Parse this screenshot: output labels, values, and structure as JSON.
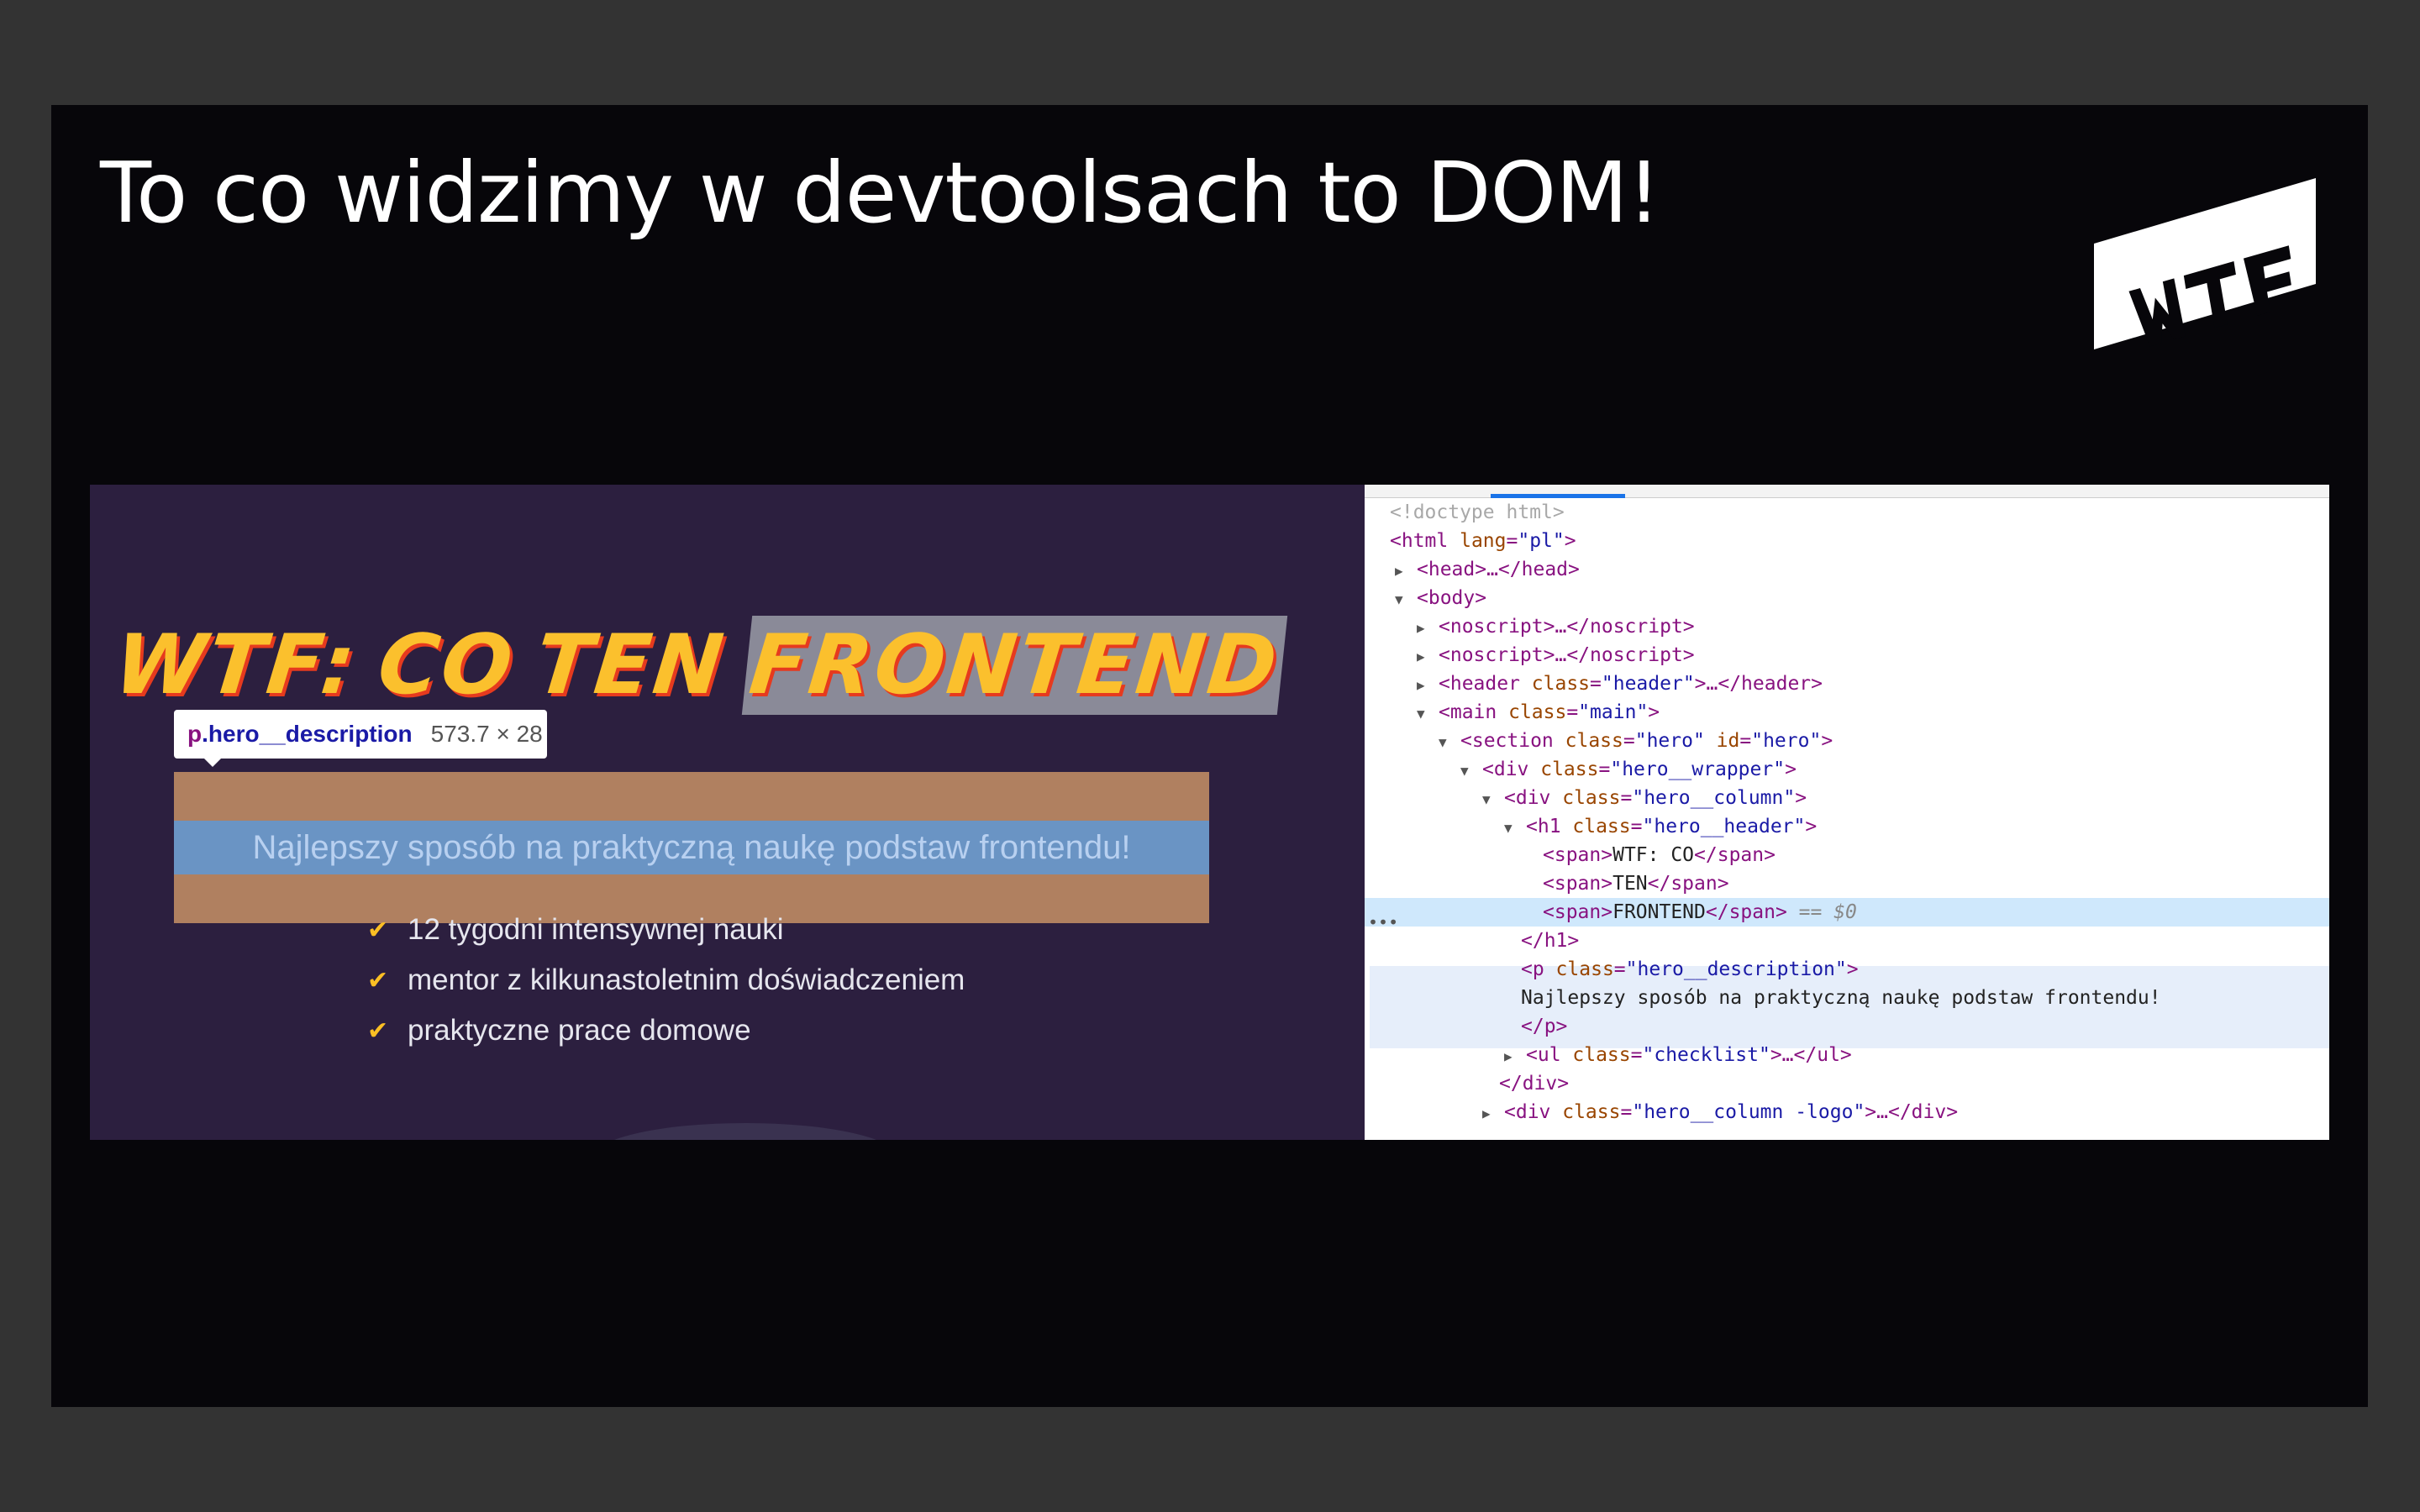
{
  "slide": {
    "title": "To co widzimy w devtoolsach to DOM!",
    "logo_text": "WTF"
  },
  "preview": {
    "heading_words": [
      "WTF:",
      "CO",
      "TEN",
      "FRONTEND"
    ],
    "tooltip": {
      "tag": "p",
      "class": ".hero__description",
      "size": "573.7 × 28"
    },
    "description": "Najlepszy sposób na praktyczną naukę podstaw frontendu!",
    "checklist": [
      "12 tygodni intensywnej nauki",
      "mentor z kilkunastoletnim doświadczeniem",
      "praktyczne prace domowe"
    ],
    "check_icon": "✔"
  },
  "devtools": {
    "selected_suffix": "== $0",
    "dots": "•••",
    "lines": {
      "l1": "<!doctype html>",
      "l2_tag": "<html",
      "l2_attr": " lang",
      "l2_val": "\"pl\"",
      "l2_end": ">",
      "l3": "<head>…</head>",
      "l4": "<body>",
      "l5": "<noscript>…</noscript>",
      "l6": "<noscript>…</noscript>",
      "l7_tag": "<header",
      "l7_attr": " class",
      "l7_val": "\"header\"",
      "l7_end": ">…</header>",
      "l8_tag": "<main",
      "l8_attr": " class",
      "l8_val": "\"main\"",
      "l8_end": ">",
      "l9_tag": "<section",
      "l9_attr": " class",
      "l9_val": "\"hero\"",
      "l9_attr2": " id",
      "l9_val2": "\"hero\"",
      "l9_end": ">",
      "l10_tag": "<div",
      "l10_attr": " class",
      "l10_val": "\"hero__wrapper\"",
      "l10_end": ">",
      "l11_tag": "<div",
      "l11_attr": " class",
      "l11_val": "\"hero__column\"",
      "l11_end": ">",
      "l12_tag": "<h1",
      "l12_attr": " class",
      "l12_val": "\"hero__header\"",
      "l12_end": ">",
      "l13_open": "<span>",
      "l13_text": "WTF: CO",
      "l13_close": "</span>",
      "l14_open": "<span>",
      "l14_text": "TEN",
      "l14_close": "</span>",
      "l15_open": "<span>",
      "l15_text": "FRONTEND",
      "l15_close": "</span>",
      "l16": "</h1>",
      "l17_tag": "<p",
      "l17_attr": " class",
      "l17_val": "\"hero__description\"",
      "l17_end": ">",
      "l18": "Najlepszy sposób na praktyczną naukę podstaw frontendu!",
      "l19": "</p>",
      "l20_tag": "<ul",
      "l20_attr": " class",
      "l20_val": "\"checklist\"",
      "l20_end": ">…</ul>",
      "l21": "</div>",
      "l22_tag": "<div",
      "l22_attr": " class",
      "l22_val": "\"hero__column -logo\"",
      "l22_end": ">…</div>"
    }
  },
  "colors": {
    "slide_bg": "#07060a",
    "outer_bg": "#333333",
    "preview_bg": "#2c1f3f",
    "heading_yellow": "#fbc02d",
    "heading_shadow": "#e63a1e",
    "selection_blue": "#cfe8fc"
  }
}
